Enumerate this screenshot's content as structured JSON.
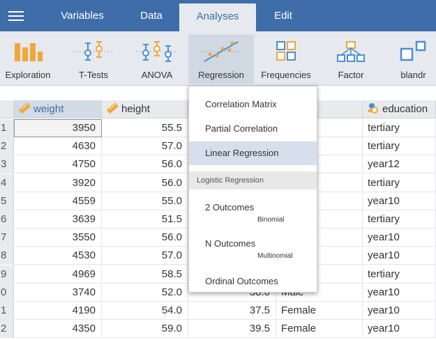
{
  "menubar": {
    "tabs": [
      "Variables",
      "Data",
      "Analyses",
      "Edit"
    ],
    "active_tab": "Analyses"
  },
  "ribbon": {
    "items": [
      {
        "label": "Exploration",
        "icon": "exploration-icon"
      },
      {
        "label": "T-Tests",
        "icon": "t-tests-icon"
      },
      {
        "label": "ANOVA",
        "icon": "anova-icon"
      },
      {
        "label": "Regression",
        "icon": "regression-icon"
      },
      {
        "label": "Frequencies",
        "icon": "frequencies-icon"
      },
      {
        "label": "Factor",
        "icon": "factor-icon"
      },
      {
        "label": "blandr",
        "icon": "blandr-icon"
      }
    ]
  },
  "grid": {
    "columns": [
      "weight",
      "height",
      "",
      "der",
      "education"
    ],
    "row_numbers": [
      "1",
      "2",
      "3",
      "4",
      "5",
      "6",
      "7",
      "8",
      "9",
      "0",
      "1",
      "2"
    ],
    "weight": [
      "3950",
      "4630",
      "4750",
      "3920",
      "4559",
      "3639",
      "3550",
      "4530",
      "4969",
      "3740",
      "4190",
      "4350"
    ],
    "height": [
      "55.5",
      "57.0",
      "56.0",
      "56.0",
      "55.0",
      "51.5",
      "56.0",
      "57.0",
      "58.5",
      "52.0",
      "54.0",
      "59.0"
    ],
    "col3": [
      "",
      "",
      "",
      "",
      "",
      "",
      "",
      "",
      "",
      "38.0",
      "37.5",
      "39.5"
    ],
    "gender": [
      "",
      "",
      "",
      "",
      "",
      "",
      "",
      "",
      "",
      "Male",
      "Female",
      "Female"
    ],
    "education": [
      "tertiary",
      "tertiary",
      "year12",
      "tertiary",
      "year10",
      "tertiary",
      "year10",
      "year10",
      "tertiary",
      "year10",
      "year10",
      "year10"
    ]
  },
  "dropdown": {
    "items": [
      "Correlation Matrix",
      "Partial Correlation",
      "Linear Regression"
    ],
    "group_header": "Logistic Regression",
    "logistic_items": [
      {
        "label": "2 Outcomes",
        "sub": "Binomial"
      },
      {
        "label": "N Outcomes",
        "sub": "Multinomial"
      },
      {
        "label": "Ordinal Outcomes",
        "sub": ""
      }
    ]
  },
  "colors": {
    "menubar": "#3e6da9",
    "ribbon_bg": "#e6e9ee",
    "icon_orange": "#f0a73a",
    "icon_blue": "#4a8fd4",
    "hover": "#d6e0ec"
  }
}
